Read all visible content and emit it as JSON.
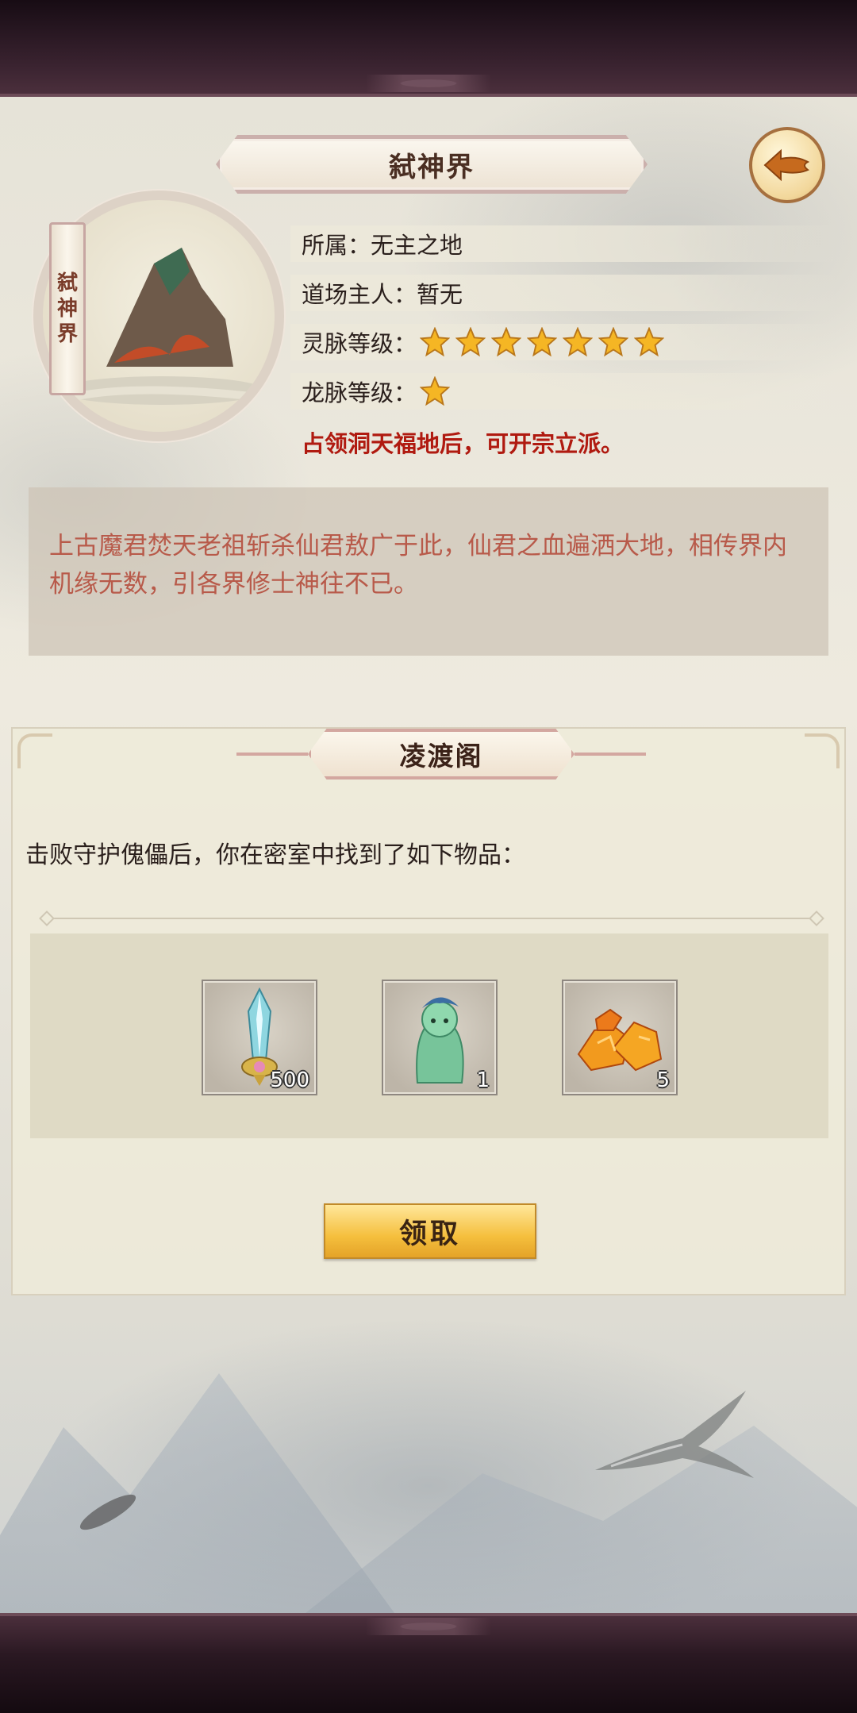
{
  "title": "弑神界",
  "scroll_chars": [
    "弑",
    "神",
    "界"
  ],
  "info": {
    "affiliation_label": "所属：",
    "affiliation_value": "无主之地",
    "owner_label": "道场主人：",
    "owner_value": "暂无",
    "spirit_label": "灵脉等级：",
    "spirit_stars": 7,
    "dragon_label": "龙脉等级：",
    "dragon_stars": 1,
    "notice": "占领洞天福地后，可开宗立派。"
  },
  "description": "上古魔君焚天老祖斩杀仙君敖广于此，仙君之血遍洒大地，相传界内机缘无数，引各界修士神往不已。",
  "reward_panel": {
    "title": "凌渡阁",
    "message": "击败守护傀儡后，你在密室中找到了如下物品：",
    "items": [
      {
        "icon": "crystal-sword-icon",
        "count": "500"
      },
      {
        "icon": "green-spirit-icon",
        "count": "1"
      },
      {
        "icon": "amber-ore-icon",
        "count": "5"
      }
    ],
    "claim_label": "领取"
  },
  "colors": {
    "accent_gold": "#f5bf3d",
    "notice_red": "#b01a10",
    "description_text": "#b85a4a"
  }
}
